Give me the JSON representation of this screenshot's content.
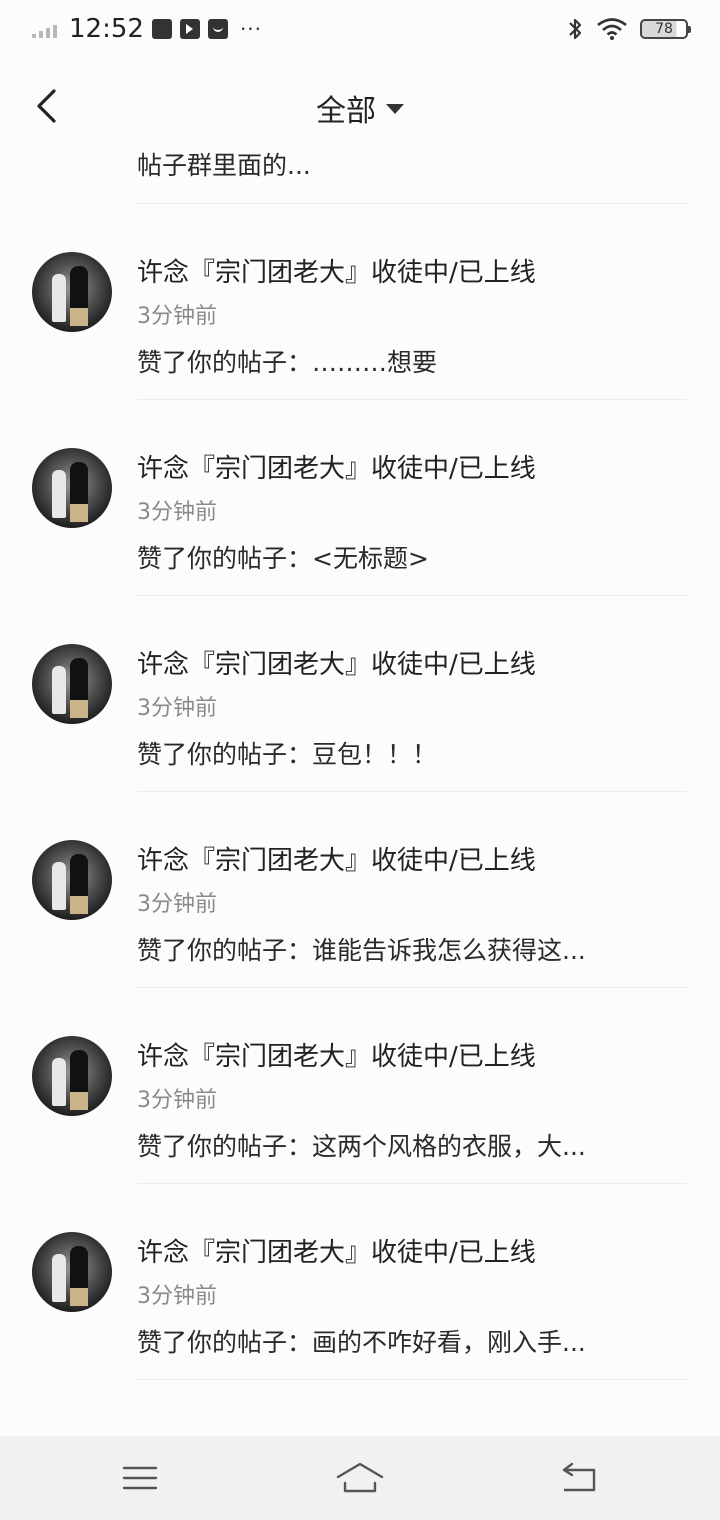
{
  "status_bar": {
    "time": "12:52",
    "more": "···",
    "battery": "78",
    "icons": [
      "signal-icon",
      "app-square-icon",
      "play-app-icon",
      "cat-app-icon",
      "bluetooth-icon",
      "wifi-icon",
      "battery-icon"
    ]
  },
  "header": {
    "title": "全部",
    "back_icon": "chevron-left-icon",
    "dropdown_icon": "caret-down-icon"
  },
  "partial_item": {
    "content": "帖子群里面的..."
  },
  "notifications": [
    {
      "name": "许念『宗门团老大』收徒中/已上线",
      "time": "3分钟前",
      "content": "赞了你的帖子：………想要"
    },
    {
      "name": "许念『宗门团老大』收徒中/已上线",
      "time": "3分钟前",
      "content": "赞了你的帖子：<无标题>"
    },
    {
      "name": "许念『宗门团老大』收徒中/已上线",
      "time": "3分钟前",
      "content": "赞了你的帖子：豆包！！！"
    },
    {
      "name": "许念『宗门团老大』收徒中/已上线",
      "time": "3分钟前",
      "content": "赞了你的帖子：谁能告诉我怎么获得这..."
    },
    {
      "name": "许念『宗门团老大』收徒中/已上线",
      "time": "3分钟前",
      "content": "赞了你的帖子：这两个风格的衣服，大..."
    },
    {
      "name": "许念『宗门团老大』收徒中/已上线",
      "time": "3分钟前",
      "content": "赞了你的帖子：画的不咋好看，刚入手..."
    }
  ],
  "nav_bar": {
    "icons": [
      "menu-icon",
      "home-icon",
      "back-icon"
    ]
  }
}
